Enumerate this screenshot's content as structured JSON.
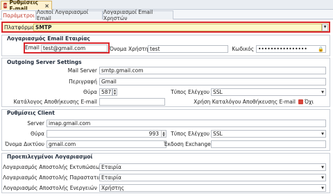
{
  "doc_tab": {
    "title": "Ρυθμίσεις E-mail",
    "close": "×"
  },
  "tabs": [
    {
      "label": "Παράμετροι"
    },
    {
      "label": "Λοιποί Λογαριασμοί Email"
    },
    {
      "label": "Λογαριασμοί Email Χρηστών"
    }
  ],
  "platform": {
    "label": "Πλατφόρμα",
    "value": "SMTP"
  },
  "company_email": {
    "title": "Λογαριασμός Email Εταιρίας",
    "email_label": "Email",
    "email_value": "test@gmail.com",
    "username_label": "Όνομα Χρήστη",
    "username_value": "test",
    "password_label": "Κωδικός",
    "password_value": "••••••••••••••••"
  },
  "outgoing": {
    "title": "Outgoing Server Settings",
    "mail_server_label": "Mail Server",
    "mail_server_value": "smtp.gmail.com",
    "description_label": "Περιγραφή",
    "description_value": "Gmail",
    "port_label": "Θύρα",
    "port_value": "587",
    "auth_type_label": "Τύπος Ελέγχου",
    "auth_type_value": "SSL",
    "sent_folder_label": "Κατάλογος Αποθήκευσης E-mail",
    "sent_folder_value": "",
    "use_user_folder_label": "Χρήση Καταλόγου Αποθήκευσης E-mail",
    "use_user_folder_value": "Όχι"
  },
  "client": {
    "title": "Ρυθμίσεις Client",
    "server_label": "Server",
    "server_value": "imap.gmail.com",
    "port_label": "Θύρα",
    "port_value": "993",
    "auth_type_label": "Τύπος Ελέγχου",
    "auth_type_value": "SSL",
    "domain_label": "Όνομα Δικτύου",
    "domain_value": "gmail.com",
    "exchange_label": "Έκδοση Exchange",
    "exchange_value": ""
  },
  "default_accounts": {
    "title": "Προεπιλεγμένοι Λογαριασμοί",
    "rows": [
      {
        "label": "Λογαριασμός Αποστολής Εκτυπώσεων",
        "value": "Εταιρία"
      },
      {
        "label": "Λογαριασμός Αποστολής Παραστατικών",
        "value": "Εταιρία"
      },
      {
        "label": "Λογαριασμός Αποστολής Ενεργειών",
        "value": "Χρήστης"
      }
    ]
  }
}
